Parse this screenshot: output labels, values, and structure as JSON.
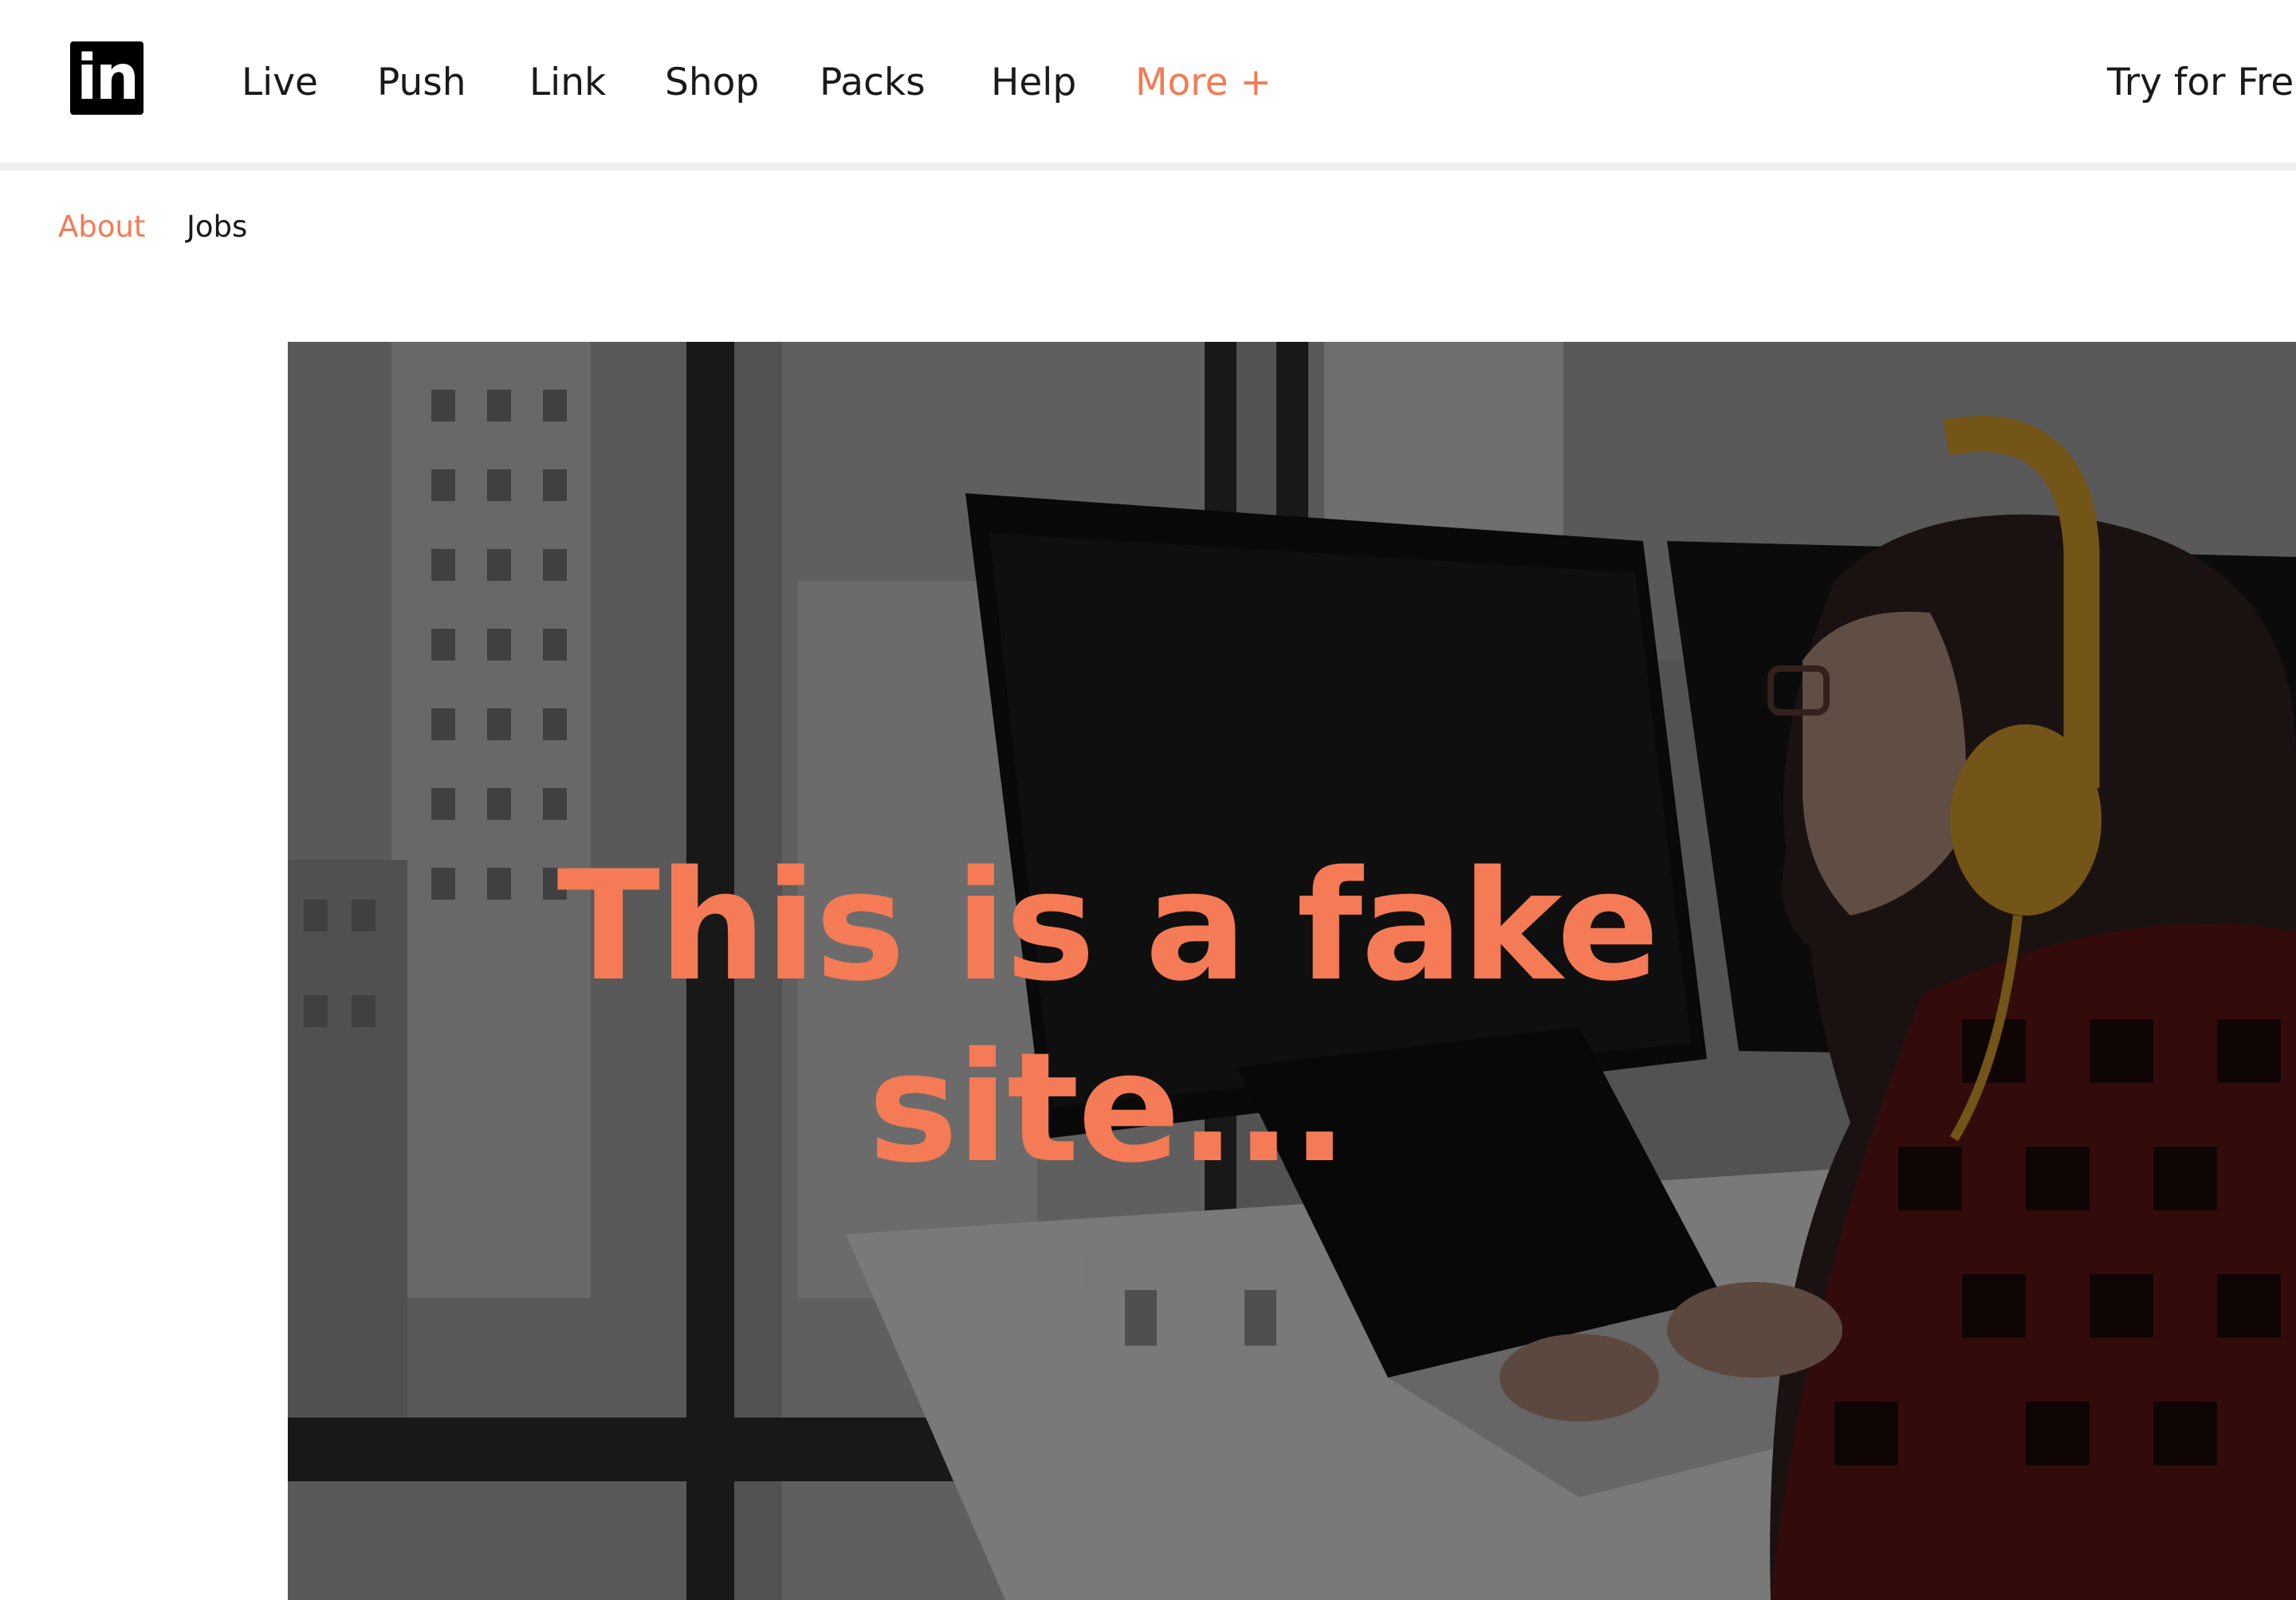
{
  "logo": {
    "text": "in"
  },
  "header": {
    "nav": [
      {
        "label": "Live"
      },
      {
        "label": "Push"
      },
      {
        "label": "Link"
      },
      {
        "label": "Shop"
      },
      {
        "label": "Packs"
      },
      {
        "label": "Help"
      },
      {
        "label": "More +"
      }
    ],
    "cta_label": "Try for Free"
  },
  "subnav": {
    "items": [
      {
        "label": "About",
        "active": true
      },
      {
        "label": "Jobs",
        "active": false
      }
    ]
  },
  "hero": {
    "headline_line1": "This is a fake",
    "headline_line2": "site..."
  },
  "colors": {
    "accent": "#f47b55",
    "text": "#1a1a1a",
    "header_bg": "#ffffff",
    "divider": "#efefef"
  }
}
